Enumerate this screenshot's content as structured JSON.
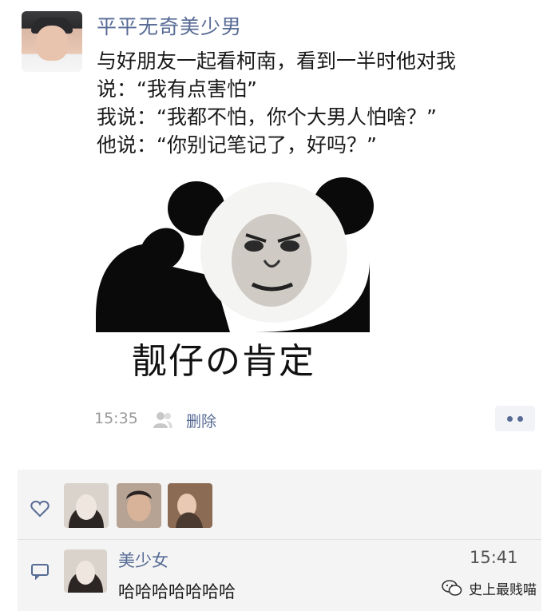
{
  "post": {
    "username": "平平无奇美少男",
    "text_lines": [
      "与好朋友一起看柯南，看到一半时他对我",
      "说：“我有点害怕”",
      "我说：“我都不怕，你个大男人怕啥？”",
      "他说：“你别记笔记了，好吗？”"
    ],
    "meme_caption": "靓仔の肯定",
    "time": "15:35",
    "delete_label": "删除"
  },
  "interactions": {
    "comment": {
      "author": "美少女",
      "time": "15:41",
      "text": "哈哈哈哈哈哈哈"
    }
  },
  "watermark": {
    "text": "史上最贱喵"
  },
  "icons": {
    "like": "heart-outline-icon",
    "comment": "comment-bubble-icon",
    "privacy": "people-icon",
    "more": "more-dots-icon",
    "watermark": "wechat-logo-icon"
  },
  "colors": {
    "link": "#576b95",
    "interaction_bg": "#f4f4f4",
    "meta_gray": "#9a9a9a"
  }
}
